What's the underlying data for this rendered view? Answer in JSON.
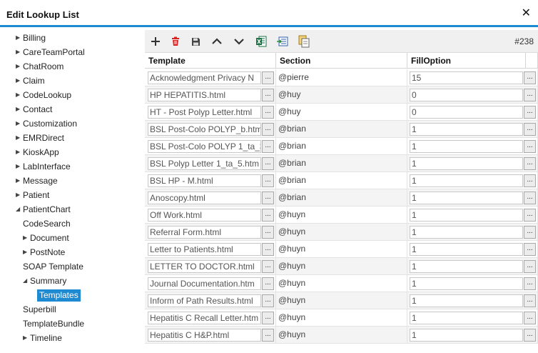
{
  "window": {
    "title": "Edit Lookup List",
    "close_label": "✕",
    "accent_color": "#1e8ad1"
  },
  "tree": [
    {
      "label": "Billing",
      "indent": 0,
      "arrow": "right"
    },
    {
      "label": "CareTeamPortal",
      "indent": 0,
      "arrow": "right"
    },
    {
      "label": "ChatRoom",
      "indent": 0,
      "arrow": "right"
    },
    {
      "label": "Claim",
      "indent": 0,
      "arrow": "right"
    },
    {
      "label": "CodeLookup",
      "indent": 0,
      "arrow": "right"
    },
    {
      "label": "Contact",
      "indent": 0,
      "arrow": "right"
    },
    {
      "label": "Customization",
      "indent": 0,
      "arrow": "right"
    },
    {
      "label": "EMRDirect",
      "indent": 0,
      "arrow": "right"
    },
    {
      "label": "KioskApp",
      "indent": 0,
      "arrow": "right"
    },
    {
      "label": "LabInterface",
      "indent": 0,
      "arrow": "right"
    },
    {
      "label": "Message",
      "indent": 0,
      "arrow": "right"
    },
    {
      "label": "Patient",
      "indent": 0,
      "arrow": "right"
    },
    {
      "label": "PatientChart",
      "indent": 0,
      "arrow": "down"
    },
    {
      "label": "CodeSearch",
      "indent": 1,
      "arrow": "none"
    },
    {
      "label": "Document",
      "indent": 1,
      "arrow": "right"
    },
    {
      "label": "PostNote",
      "indent": 1,
      "arrow": "right"
    },
    {
      "label": "SOAP Template",
      "indent": 1,
      "arrow": "none"
    },
    {
      "label": "Summary",
      "indent": 1,
      "arrow": "down"
    },
    {
      "label": "Templates",
      "indent": 2,
      "arrow": "none",
      "selected": true
    },
    {
      "label": "Superbill",
      "indent": 1,
      "arrow": "none"
    },
    {
      "label": "TemplateBundle",
      "indent": 1,
      "arrow": "none"
    },
    {
      "label": "Timeline",
      "indent": 1,
      "arrow": "right"
    }
  ],
  "toolbar": {
    "buttons": [
      "add-icon",
      "delete-icon",
      "save-icon",
      "move-up-icon",
      "move-down-icon",
      "excel-export-icon",
      "import-icon",
      "copy-icon"
    ],
    "counter": "#238"
  },
  "grid": {
    "columns": [
      "Template",
      "Section",
      "FillOption"
    ],
    "ellipsis_label": "...",
    "rows": [
      {
        "template": "Acknowledgment Privacy N",
        "section": "@pierre",
        "fill": "15"
      },
      {
        "template": "HP HEPATITIS.html",
        "section": "@huy",
        "fill": "0"
      },
      {
        "template": "HT - Post Polyp Letter.html",
        "section": "@huy",
        "fill": "0"
      },
      {
        "template": "BSL Post-Colo POLYP_b.htm",
        "section": "@brian",
        "fill": "1"
      },
      {
        "template": "BSL Post-Colo POLYP 1_ta_3",
        "section": "@brian",
        "fill": "1"
      },
      {
        "template": "BSL Polyp Letter 1_ta_5.htm",
        "section": "@brian",
        "fill": "1"
      },
      {
        "template": "BSL HP - M.html",
        "section": "@brian",
        "fill": "1"
      },
      {
        "template": "Anoscopy.html",
        "section": "@brian",
        "fill": "1"
      },
      {
        "template": "Off Work.html",
        "section": "@huyn",
        "fill": "1"
      },
      {
        "template": "Referral Form.html",
        "section": "@huyn",
        "fill": "1"
      },
      {
        "template": "Letter to Patients.html",
        "section": "@huyn",
        "fill": "1"
      },
      {
        "template": "LETTER TO DOCTOR.html",
        "section": "@huyn",
        "fill": "1"
      },
      {
        "template": "Journal Documentation.htm",
        "section": "@huyn",
        "fill": "1"
      },
      {
        "template": "Inform of Path Results.html",
        "section": "@huyn",
        "fill": "1"
      },
      {
        "template": "Hepatitis C Recall Letter.htm",
        "section": "@huyn",
        "fill": "1"
      },
      {
        "template": "Hepatitis C H&P.html",
        "section": "@huyn",
        "fill": "1"
      }
    ]
  }
}
